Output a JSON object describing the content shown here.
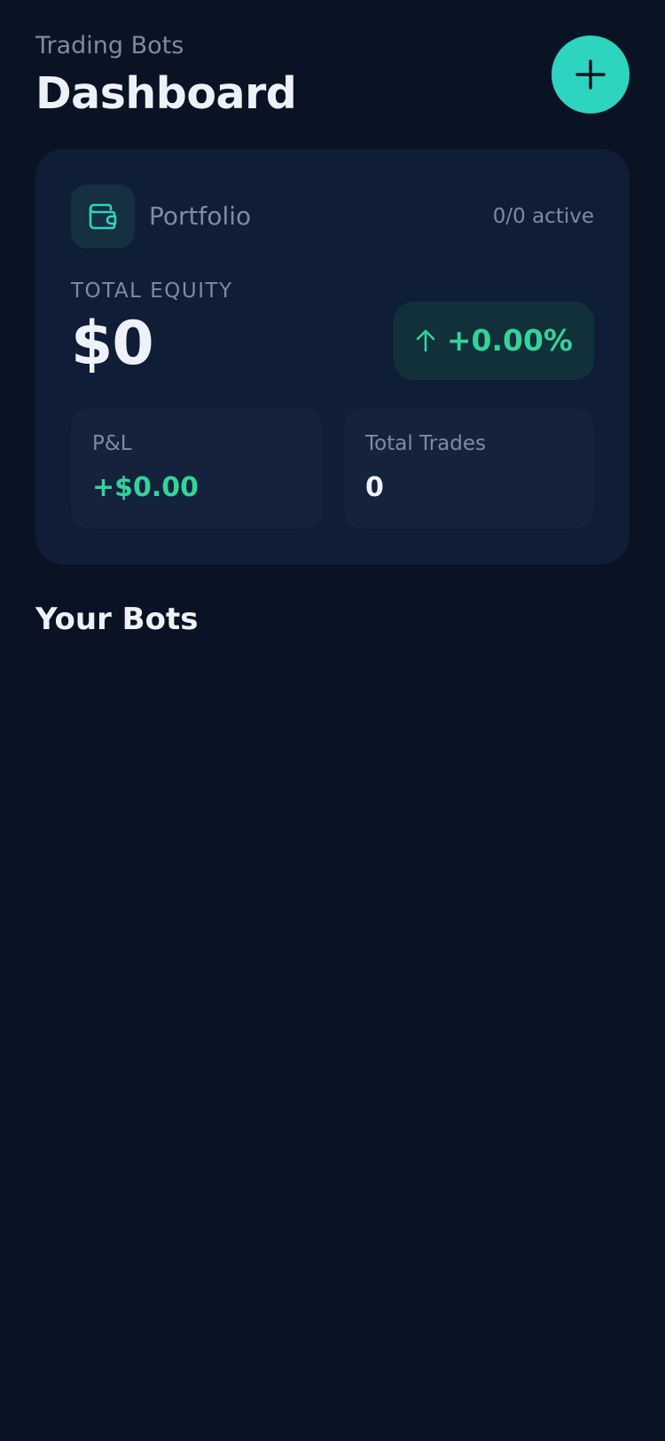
{
  "header": {
    "subtitle": "Trading Bots",
    "title": "Dashboard",
    "add_icon": "plus-icon"
  },
  "portfolio": {
    "icon": "wallet-icon",
    "label": "Portfolio",
    "active_count": "0/0 active",
    "equity_label": "TOTAL EQUITY",
    "equity_value": "$0",
    "change_icon": "arrow-up-icon",
    "change": "+0.00%",
    "pnl_label": "P&L",
    "pnl_value": "+$0.00",
    "trades_label": "Total Trades",
    "trades_value": "0"
  },
  "bots": {
    "section_title": "Your Bots",
    "items": []
  },
  "colors": {
    "background": "#0a1324",
    "card": "#101d36",
    "accent": "#2dd4bf",
    "positive": "#34d399",
    "muted_text": "#7d8ba3",
    "primary_text": "#eef2f8"
  }
}
